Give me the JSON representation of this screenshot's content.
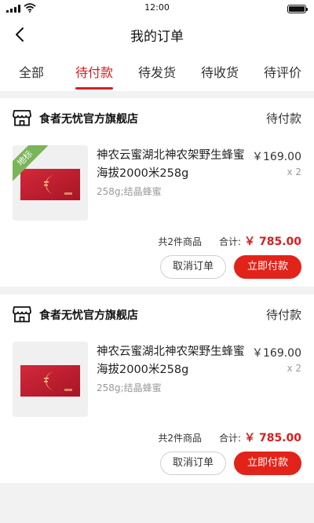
{
  "status_bar": {
    "time": "12:00",
    "signal_icon": "signal-icon",
    "wifi_icon": "wifi-icon",
    "battery_icon": "battery-icon"
  },
  "nav": {
    "title": "我的订单",
    "back_icon": "back-arrow-icon"
  },
  "tabs": [
    {
      "label": "全部",
      "active": false
    },
    {
      "label": "待付款",
      "active": true
    },
    {
      "label": "待发货",
      "active": false
    },
    {
      "label": "待收货",
      "active": false
    },
    {
      "label": "待评价",
      "active": false
    }
  ],
  "orders": [
    {
      "shop_icon": "store-icon",
      "shop_name": "食者无忧官方旗舰店",
      "status": "待付款",
      "tag": "地标",
      "product_name": "神农云蜜湖北神农架野生蜂蜜海拔2000米258g",
      "spec": "258g;结晶蜂蜜",
      "price": "￥169.00",
      "qty": "x 2",
      "count_text": "共2件商品",
      "total_label": "合计:",
      "total_amount": "￥ 785.00",
      "cancel_label": "取消订单",
      "pay_label": "立即付款"
    },
    {
      "shop_icon": "store-icon",
      "shop_name": "食者无忧官方旗舰店",
      "status": "待付款",
      "product_name": "神农云蜜湖北神农架野生蜂蜜海拔2000米258g",
      "spec": "258g;结晶蜂蜜",
      "price": "￥169.00",
      "qty": "x 2",
      "count_text": "共2件商品",
      "total_label": "合计:",
      "total_amount": "￥ 785.00",
      "cancel_label": "取消订单",
      "pay_label": "立即付款"
    }
  ],
  "colors": {
    "accent": "#e2231a",
    "tag_green": "#7ab55a",
    "background": "#f2f2f2"
  }
}
